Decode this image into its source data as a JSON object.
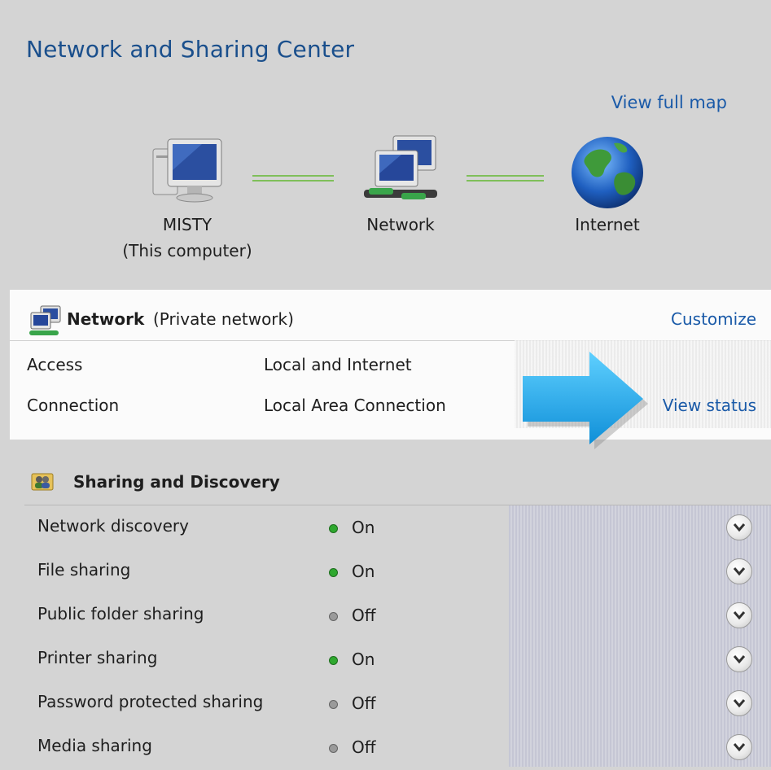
{
  "title": "Network and Sharing Center",
  "map": {
    "view_full_map": "View full map",
    "computer_name": "MISTY",
    "computer_sub": "(This computer)",
    "network_label": "Network",
    "internet_label": "Internet"
  },
  "network": {
    "name": "Network",
    "type": "(Private network)",
    "customize": "Customize",
    "rows": [
      {
        "label": "Access",
        "value": "Local and Internet"
      },
      {
        "label": "Connection",
        "value": "Local Area Connection",
        "action": "View status"
      }
    ]
  },
  "sharing": {
    "title": "Sharing and Discovery",
    "on_color": "#2fa82f",
    "off_color": "#9a9a9a",
    "rows": [
      {
        "label": "Network discovery",
        "state": "On"
      },
      {
        "label": "File sharing",
        "state": "On"
      },
      {
        "label": "Public folder sharing",
        "state": "Off"
      },
      {
        "label": "Printer sharing",
        "state": "On"
      },
      {
        "label": "Password protected sharing",
        "state": "Off"
      },
      {
        "label": "Media sharing",
        "state": "Off"
      }
    ]
  },
  "icons": {
    "computer": "computer-monitor-icon",
    "network": "network-computers-icon",
    "internet": "globe-icon",
    "sharing": "people-folder-icon",
    "arrow": "blue-arrow-pointer",
    "expand": "chevron-down-circle-icon"
  }
}
